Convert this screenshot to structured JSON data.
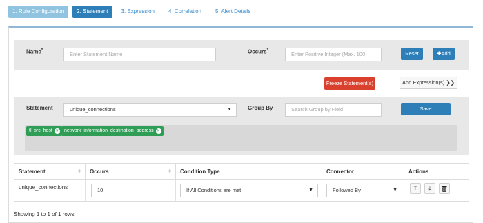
{
  "wizard": {
    "steps": [
      {
        "label": "1. Rule Configuration"
      },
      {
        "label": "2. Statement"
      },
      {
        "label": "3. Expression"
      },
      {
        "label": "4. Correlation"
      },
      {
        "label": "5. Alert Details"
      }
    ]
  },
  "form": {
    "name_label": "Name",
    "name_required": "*",
    "name_placeholder": "Enter Statement Name",
    "occurs_label": "Occurs",
    "occurs_required": "*",
    "occurs_placeholder": "Enter Positive Integer (Max. 100)",
    "reset_label": "Reset",
    "add_label": "Add",
    "freeze_label": "Freeze Statement(s)",
    "add_expression_label": "Add Expression(s)",
    "add_expression_arrows": "❯❯"
  },
  "statement_editor": {
    "statement_label": "Statement",
    "statement_value": "unique_connections",
    "group_by_label": "Group By",
    "group_by_placeholder": "Search Group by Field",
    "save_label": "Save",
    "tags": [
      {
        "label": "tl_src_host"
      },
      {
        "label": "network_information_destination_address"
      }
    ]
  },
  "table": {
    "headers": [
      "Statement",
      "Occurs",
      "Condition Type",
      "Connector",
      "Actions"
    ],
    "rows": [
      {
        "statement": "unique_connections",
        "occurs": "10",
        "condition_type": "If All Conditions are met",
        "connector": "Followed By"
      }
    ]
  },
  "footer": {
    "showing_text": "Showing 1 to 1 of 1 rows"
  },
  "icons": {
    "remove_tag": "circle-x-icon",
    "plus": "plus-icon",
    "caret": "caret-down-icon",
    "up": "arrow-up-icon",
    "down": "arrow-down-icon",
    "trash": "trash-icon",
    "sort": "sort-icon"
  },
  "colors": {
    "primary_blue": "#2e7fb8",
    "light_blue": "#8fc3e0",
    "red": "#d9412e",
    "tag_green": "#2f9d55",
    "panel_grey": "#e8e8e8"
  }
}
